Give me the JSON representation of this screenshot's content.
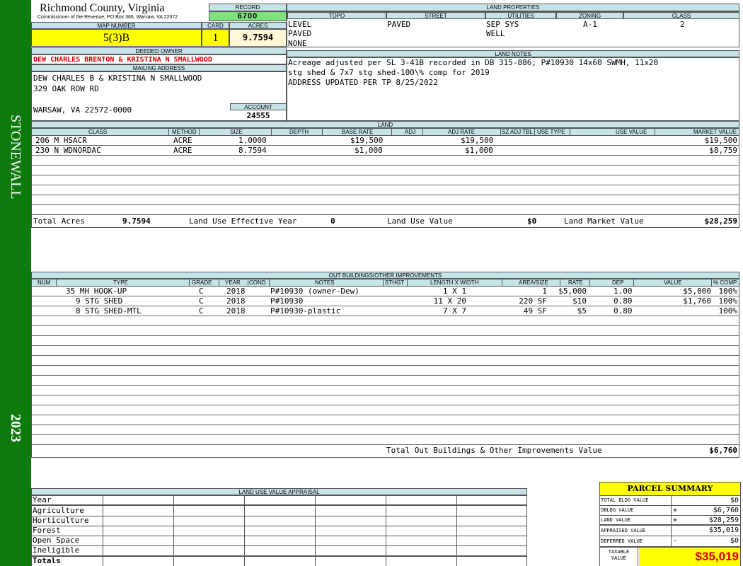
{
  "sidebar": {
    "district": "STONEWALL",
    "year": "2023"
  },
  "header": {
    "county": "Richmond County, Virginia",
    "commissioner": "Commissioner of the Revenue, PO Box 366, Warsaw, VA 22572",
    "record_label": "RECORD",
    "record": "6700",
    "map_label": "MAP NUMBER",
    "map_number": "5(3)B",
    "card_label": "CARD",
    "card": "1",
    "acres_label": "ACRES",
    "acres": "9.7594",
    "owner_label": "DEEDED OWNER",
    "owner": "DEW CHARLES BRENTON & KRISTINA N SMALLWOOD",
    "mailing_label": "MAILING ADDRESS",
    "mailing": [
      "DEW CHARLES B & KRISTINA N SMALLWOOD",
      "329 OAK ROW RD",
      "",
      "WARSAW, VA 22572-0000"
    ],
    "account_label": "ACCOUNT",
    "account": "24555"
  },
  "land_properties": {
    "title": "LAND PROPERTIES",
    "columns": [
      "TOPO",
      "STREET",
      "UTILITIES",
      "ZONING",
      "CLASS"
    ],
    "topo": [
      "LEVEL",
      "PAVED",
      "NONE"
    ],
    "street": "PAVED",
    "utilities": [
      "SEP SYS",
      "WELL"
    ],
    "zoning": "A-1",
    "class": "2"
  },
  "land_notes": {
    "title": "LAND NOTES",
    "lines": [
      "Acreage adjusted per SL 3-41B recorded in DB 315-886; P#10930 14x60 SWMH, 11x20",
      "stg shed & 7x7 stg shed-100\\% comp for 2019",
      "ADDRESS UPDATED PER TP 8/25/2022"
    ]
  },
  "land": {
    "title": "LAND",
    "columns": [
      "CLASS",
      "METHOD",
      "SIZE",
      "DEPTH",
      "BASE RATE",
      "ADJ",
      "ADJ RATE",
      "SZ ADJ TBL",
      "USE TYPE",
      "USE VALUE",
      "MARKET VALUE"
    ],
    "rows": [
      {
        "class": "206 M HSACR",
        "method": "ACRE",
        "size": "1.0000",
        "base_rate": "$19,500",
        "adj_rate": "$19,500",
        "market": "$19,500"
      },
      {
        "class": "230 N WDNORDAC",
        "method": "ACRE",
        "size": "8.7594",
        "base_rate": "$1,000",
        "adj_rate": "$1,000",
        "market": "$8,759"
      }
    ],
    "total_acres_label": "Total Acres",
    "total_acres": "9.7594",
    "effective_year_label": "Land Use Effective Year",
    "effective_year": "0",
    "use_value_label": "Land Use Value",
    "use_value": "$0",
    "market_value_label": "Land Market Value",
    "market_value": "$28,259"
  },
  "outbuildings": {
    "title": "OUT BUILDINGS/OTHER IMPROVEMENTS",
    "columns": [
      "NUM",
      "TYPE",
      "GRADE",
      "YEAR",
      "COND",
      "NOTES",
      "STHGT",
      "LENGTH X WIDTH",
      "AREA/SIZE",
      "RATE",
      "DEP",
      "VALUE",
      "% COMP"
    ],
    "rows": [
      {
        "type": "35 MH HOOK-UP",
        "grade": "C",
        "year": "2018",
        "notes": "P#10930 (owner-Dew)",
        "lxw": "1 X 1",
        "area": "1",
        "rate": "$5,000",
        "dep": "1.00",
        "value": "$5,000",
        "comp": "100%"
      },
      {
        "type": "9 STG SHED",
        "grade": "C",
        "year": "2018",
        "notes": "P#10930",
        "lxw": "11 X 20",
        "area": "220 SF",
        "rate": "$10",
        "dep": "0.80",
        "value": "$1,760",
        "comp": "100%"
      },
      {
        "type": "8 STG SHED-MTL",
        "grade": "C",
        "year": "2018",
        "notes": "P#10930-plastic",
        "lxw": "7 X 7",
        "area": "49 SF",
        "rate": "$5",
        "dep": "0.80",
        "value": "",
        "comp": "100%"
      }
    ],
    "total_label": "Total Out Buildings & Other Improvements Value",
    "total": "$6,760"
  },
  "land_use_appraisal": {
    "title": "LAND USE VALUE APPRAISAL",
    "rows": [
      "Year",
      "Agriculture",
      "Horticulture",
      "Forest",
      "Open Space",
      "Ineligible",
      "Totals"
    ]
  },
  "parcel_summary": {
    "title": "PARCEL SUMMARY",
    "rows": [
      {
        "label": "TOTAL BLDG VALUE",
        "sign": "",
        "value": "$0"
      },
      {
        "label": "OBLDG VALUE",
        "sign": "+",
        "value": "$6,760"
      },
      {
        "label": "LAND VALUE",
        "sign": "+",
        "value": "$28,259"
      },
      {
        "label": "APPRAISED VALUE",
        "sign": "",
        "value": "$35,019"
      },
      {
        "label": "DEFERRED VALUE",
        "sign": "-",
        "value": "$0"
      }
    ],
    "taxable_label_1": "TAXABLE",
    "taxable_label_2": "VALUE",
    "taxable": "$35,019"
  },
  "colors": {
    "sidebar": "#0e7a0e",
    "header_bg": "#c6e3ea",
    "highlight": "#ffff00",
    "record_bg": "#7fe07f",
    "owner_text": "#d40000"
  }
}
